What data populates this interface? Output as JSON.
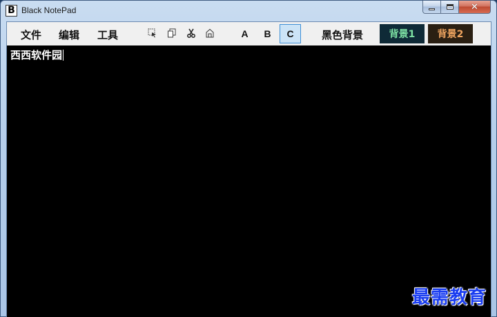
{
  "window": {
    "title": "Black NotePad",
    "icon_letter": "B"
  },
  "menu": {
    "items": [
      "文件",
      "编辑",
      "工具"
    ]
  },
  "tools": {
    "icons": [
      "select-all-icon",
      "copy-icon",
      "cut-icon",
      "paste-icon"
    ]
  },
  "fonts": {
    "buttons": [
      "A",
      "B",
      "C"
    ],
    "selected": "C"
  },
  "background": {
    "label": "黑色背景",
    "bg1_label": "背景1",
    "bg2_label": "背景2",
    "bg1_color": "#7ee2a4",
    "bg2_color": "#f0a560"
  },
  "editor": {
    "text": "西西软件园",
    "background_color": "#000000",
    "text_color": "#ffffff"
  },
  "watermark": {
    "text": "最需教育",
    "color": "#1a3df0"
  }
}
